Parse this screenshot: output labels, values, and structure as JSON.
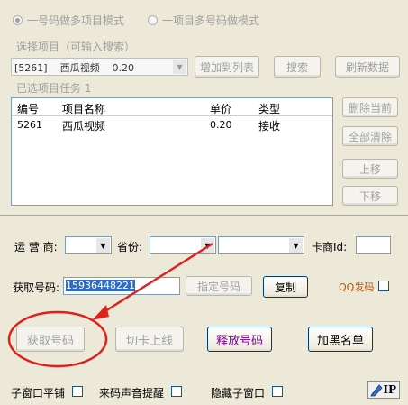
{
  "mode": {
    "option1": "一号码做多项目模式",
    "option2": "一项目多号码做模式"
  },
  "project": {
    "label": "选择项目（可输入搜索）",
    "selected": "[5261]    西瓜视频    0.20",
    "add_button": "增加到列表",
    "search_button": "搜索",
    "refresh_button": "刷新数据",
    "tasks_label": "已选项目任务 1"
  },
  "table": {
    "columns": [
      "编号",
      "项目名称",
      "单价",
      "类型"
    ],
    "rows": [
      {
        "id": "5261",
        "name": "西瓜视频",
        "price": "0.20",
        "type": "接收"
      }
    ]
  },
  "side_buttons": {
    "delete_current": "删除当前",
    "clear_all": "全部清除",
    "move_up": "上移",
    "move_down": "下移"
  },
  "filters": {
    "carrier_label": "运 营 商:",
    "province_label": "省份:",
    "card_id_label": "卡商Id:"
  },
  "number": {
    "label": "获取号码:",
    "value": "15936448221",
    "specify_button": "指定号码",
    "copy_button": "复制",
    "qq_label": "QQ发码"
  },
  "actions": {
    "get_number": "获取号码",
    "switch_online": "切卡上线",
    "release_number": "释放号码",
    "blacklist": "加黑名单"
  },
  "footer": {
    "sub_window_tile": "子窗口平铺",
    "sound_alert": "来码声音提醒",
    "hide_sub_window": "隐藏子窗口",
    "ip_badge": "IP"
  },
  "colors": {
    "annotation_red": "#e0201c",
    "release_purple": "#8000a0",
    "qq_orange": "#c05000"
  }
}
